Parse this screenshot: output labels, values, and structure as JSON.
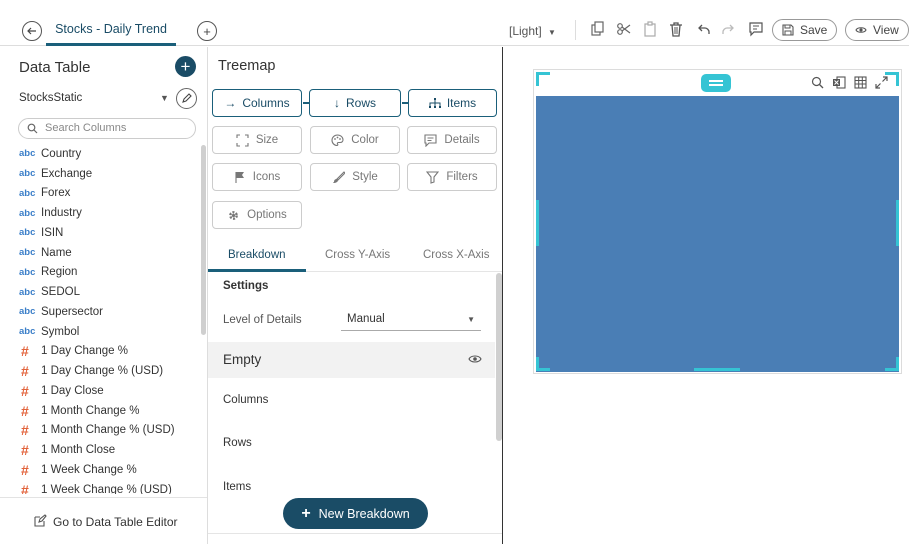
{
  "header": {
    "tab_label": "Stocks - Daily Trend",
    "theme": "[Light]",
    "save_label": "Save",
    "view_label": "View"
  },
  "data_table": {
    "title": "Data Table",
    "data_source": "StocksStatic",
    "search_placeholder": "Search Columns",
    "columns": [
      {
        "type": "abc",
        "name": "Country"
      },
      {
        "type": "abc",
        "name": "Exchange"
      },
      {
        "type": "abc",
        "name": "Forex"
      },
      {
        "type": "abc",
        "name": "Industry"
      },
      {
        "type": "abc",
        "name": "ISIN"
      },
      {
        "type": "abc",
        "name": "Name"
      },
      {
        "type": "abc",
        "name": "Region"
      },
      {
        "type": "abc",
        "name": "SEDOL"
      },
      {
        "type": "abc",
        "name": "Supersector"
      },
      {
        "type": "abc",
        "name": "Symbol"
      },
      {
        "type": "#",
        "name": "1 Day Change %"
      },
      {
        "type": "#",
        "name": "1 Day Change % (USD)"
      },
      {
        "type": "#",
        "name": "1 Day Close"
      },
      {
        "type": "#",
        "name": "1 Month Change %"
      },
      {
        "type": "#",
        "name": "1 Month Change % (USD)"
      },
      {
        "type": "#",
        "name": "1 Month Close"
      },
      {
        "type": "#",
        "name": "1 Week Change %"
      },
      {
        "type": "#",
        "name": "1 Week Change % (USD)"
      }
    ],
    "footer_link": "Go to Data Table Editor"
  },
  "visualization": {
    "title": "Treemap",
    "axis_buttons": {
      "columns": "Columns",
      "rows": "Rows",
      "items": "Items"
    },
    "option_buttons": {
      "size": "Size",
      "color": "Color",
      "details": "Details",
      "icons": "Icons",
      "style": "Style",
      "filters": "Filters",
      "options": "Options"
    },
    "tabs": [
      "Breakdown",
      "Cross Y-Axis",
      "Cross X-Axis"
    ],
    "settings_label": "Settings",
    "level_of_details_label": "Level of Details",
    "level_of_details_value": "Manual",
    "breakdown_title": "Empty",
    "breakdown_items": [
      "Columns",
      "Rows",
      "Items"
    ],
    "new_breakdown_label": "New Breakdown"
  },
  "colors": {
    "accent": "#1a4c66",
    "treemap_fill": "#4a7eb5",
    "selection": "#35c4d4",
    "text_type": "#3a7ec8",
    "numeric_type": "#e2623a"
  }
}
